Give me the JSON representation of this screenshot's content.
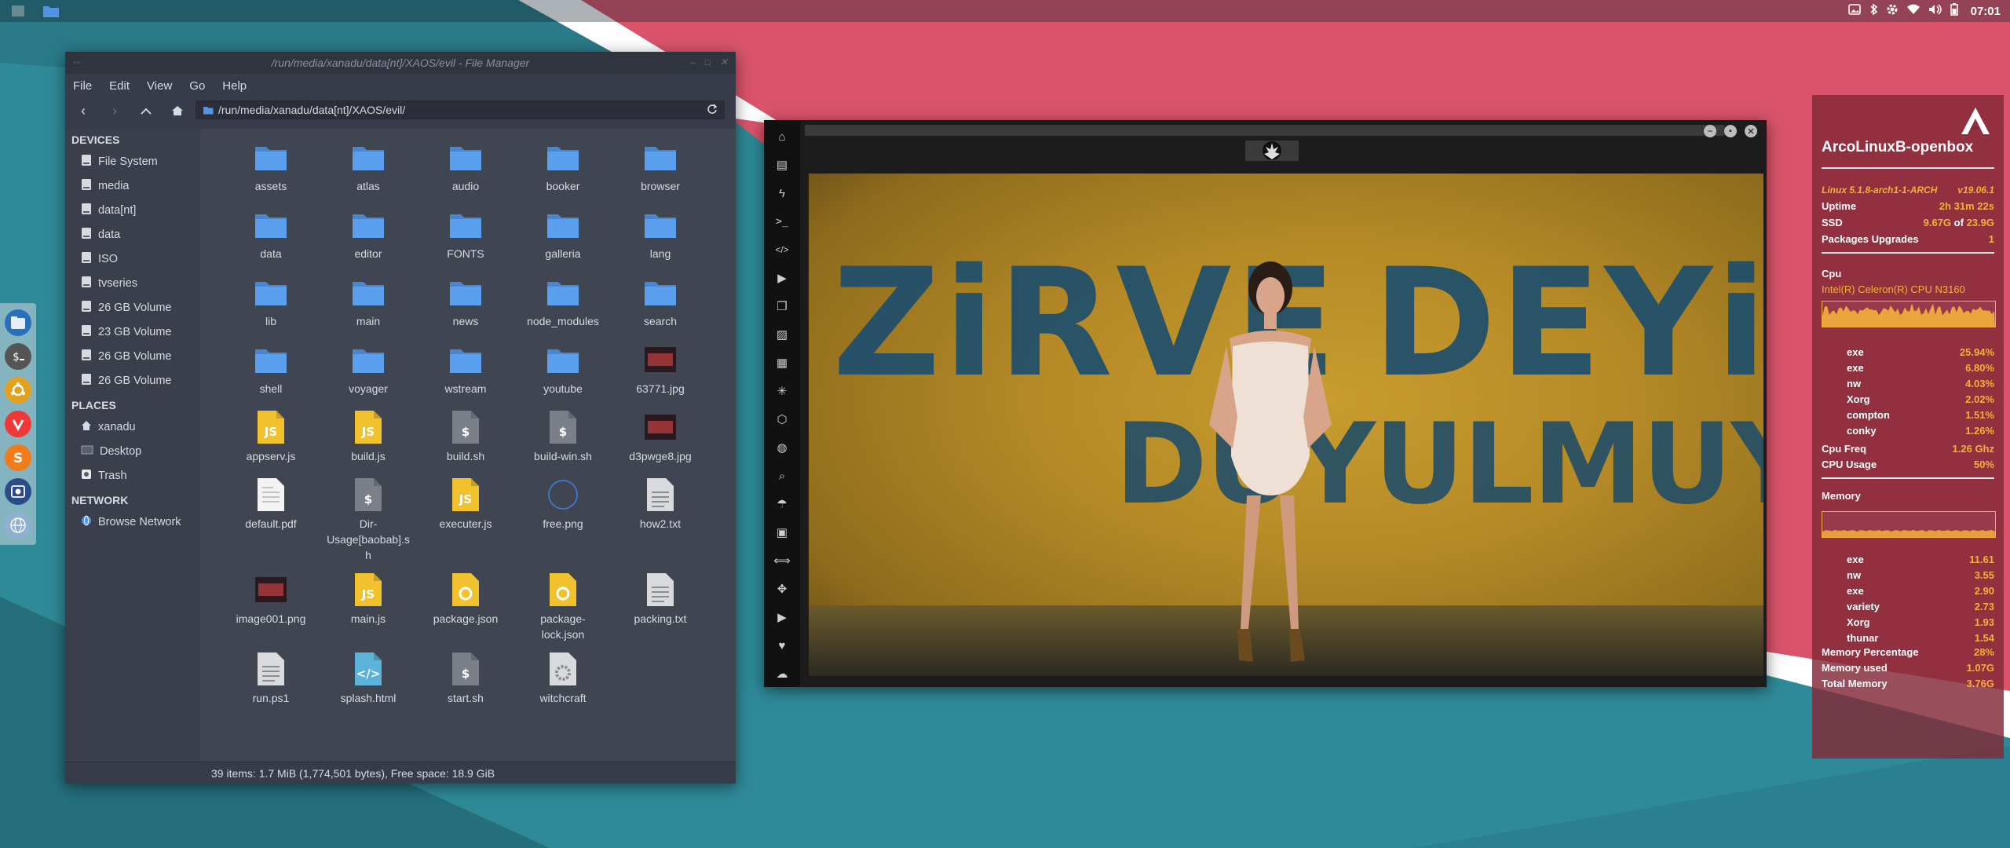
{
  "colors": {
    "accent_folder": "#5294e2",
    "conky_value": "#f3b13c",
    "fm_bg": "#404552",
    "fm_sidebar": "#3b3f4c",
    "wallpaper_teal": "#2f8a98",
    "wallpaper_red": "#d9546a"
  },
  "tray": {
    "clock": "07:01",
    "icons": [
      "image-icon",
      "bluetooth-icon",
      "settings-icon",
      "wifi-icon",
      "volume-icon",
      "battery-icon"
    ]
  },
  "file_manager": {
    "title": "/run/media/xanadu/data[nt]/XAOS/evil - File Manager",
    "menu": [
      "File",
      "Edit",
      "View",
      "Go",
      "Help"
    ],
    "path": "/run/media/xanadu/data[nt]/XAOS/evil/",
    "sidebar": {
      "devices_label": "DEVICES",
      "devices": [
        "File System",
        "media",
        "data[nt]",
        "data",
        "ISO",
        "tvseries",
        "26 GB Volume",
        "23 GB Volume",
        "26 GB Volume",
        "26 GB Volume"
      ],
      "places_label": "PLACES",
      "places": [
        "xanadu",
        "Desktop",
        "Trash"
      ],
      "network_label": "NETWORK",
      "network": [
        "Browse Network"
      ]
    },
    "files": [
      {
        "name": "assets",
        "type": "folder"
      },
      {
        "name": "atlas",
        "type": "folder"
      },
      {
        "name": "audio",
        "type": "folder"
      },
      {
        "name": "booker",
        "type": "folder"
      },
      {
        "name": "browser",
        "type": "folder"
      },
      {
        "name": "data",
        "type": "folder"
      },
      {
        "name": "editor",
        "type": "folder"
      },
      {
        "name": "FONTS",
        "type": "folder"
      },
      {
        "name": "galleria",
        "type": "folder"
      },
      {
        "name": "lang",
        "type": "folder"
      },
      {
        "name": "lib",
        "type": "folder"
      },
      {
        "name": "main",
        "type": "folder"
      },
      {
        "name": "news",
        "type": "folder"
      },
      {
        "name": "node_modules",
        "type": "folder"
      },
      {
        "name": "search",
        "type": "folder"
      },
      {
        "name": "shell",
        "type": "folder"
      },
      {
        "name": "voyager",
        "type": "folder"
      },
      {
        "name": "wstream",
        "type": "folder"
      },
      {
        "name": "youtube",
        "type": "folder"
      },
      {
        "name": "63771.jpg",
        "type": "image"
      },
      {
        "name": "appserv.js",
        "type": "js"
      },
      {
        "name": "build.js",
        "type": "js"
      },
      {
        "name": "build.sh",
        "type": "sh"
      },
      {
        "name": "build-win.sh",
        "type": "sh"
      },
      {
        "name": "d3pwge8.jpg",
        "type": "image"
      },
      {
        "name": "default.pdf",
        "type": "pdf"
      },
      {
        "name": "Dir-Usage[baobab].sh",
        "type": "sh"
      },
      {
        "name": "executer.js",
        "type": "js"
      },
      {
        "name": "free.png",
        "type": "png"
      },
      {
        "name": "how2.txt",
        "type": "txt"
      },
      {
        "name": "image001.png",
        "type": "image"
      },
      {
        "name": "main.js",
        "type": "js"
      },
      {
        "name": "package.json",
        "type": "json"
      },
      {
        "name": "package-lock.json",
        "type": "json"
      },
      {
        "name": "packing.txt",
        "type": "txt"
      },
      {
        "name": "run.ps1",
        "type": "txt"
      },
      {
        "name": "splash.html",
        "type": "html"
      },
      {
        "name": "start.sh",
        "type": "sh"
      },
      {
        "name": "witchcraft",
        "type": "exec"
      }
    ],
    "status": "39 items: 1.7 MiB (1,774,501 bytes), Free space: 18.9 GiB"
  },
  "viewer": {
    "image_text_line1_a": "ZiRVE",
    "image_text_line1_b": "DEYiM",
    "image_text_line2": "DUYULMUYOR"
  },
  "conky": {
    "host": "ArcoLinuxB-openbox",
    "kernel": "Linux 5.1.8-arch1-1-ARCH",
    "version": "v19.06.1",
    "uptime_label": "Uptime",
    "uptime": "2h 31m 22s",
    "ssd_label": "SSD",
    "ssd_used": "9.67G",
    "ssd_of": "of",
    "ssd_total": "23.9G",
    "pkg_label": "Packages Upgrades",
    "pkg_value": "1",
    "cpu_label": "Cpu",
    "cpu_model": "Intel(R) Celeron(R) CPU  N3160",
    "cpu_procs": [
      {
        "name": "exe",
        "value": "25.94%"
      },
      {
        "name": "exe",
        "value": "6.80%"
      },
      {
        "name": "nw",
        "value": "4.03%"
      },
      {
        "name": "Xorg",
        "value": "2.02%"
      },
      {
        "name": "compton",
        "value": "1.51%"
      },
      {
        "name": "conky",
        "value": "1.26%"
      }
    ],
    "cpu_freq_label": "Cpu Freq",
    "cpu_freq": "1.26 Ghz",
    "cpu_usage_label": "CPU Usage",
    "cpu_usage": "50%",
    "memory_label": "Memory",
    "mem_procs": [
      {
        "name": "exe",
        "value": "11.61"
      },
      {
        "name": "nw",
        "value": "3.55"
      },
      {
        "name": "exe",
        "value": "2.90"
      },
      {
        "name": "variety",
        "value": "2.73"
      },
      {
        "name": "Xorg",
        "value": "1.93"
      },
      {
        "name": "thunar",
        "value": "1.54"
      }
    ],
    "mem_pct_label": "Memory Percentage",
    "mem_pct": "28%",
    "mem_used_label": "Memory used",
    "mem_used": "1.07G",
    "mem_total_label": "Total Memory",
    "mem_total": "3.76G"
  }
}
